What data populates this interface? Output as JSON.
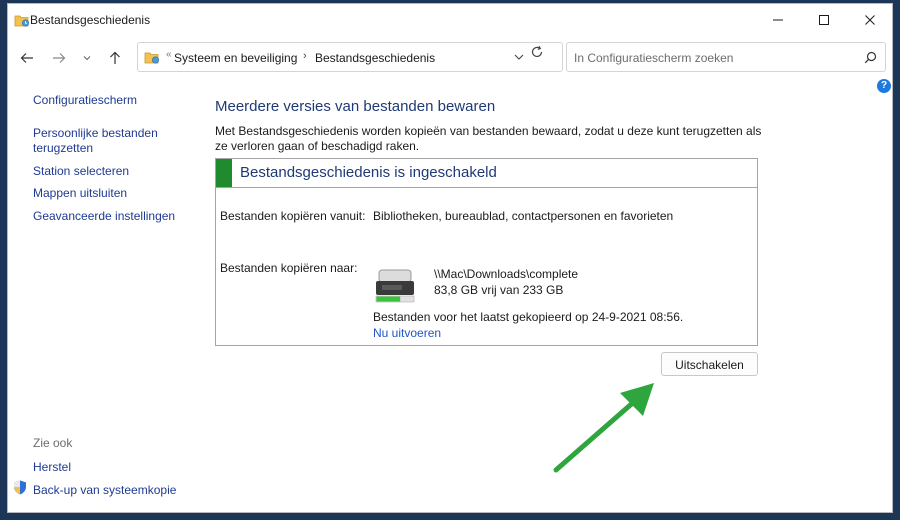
{
  "window": {
    "title": "Bestandsgeschiedenis",
    "minimize_icon": "minimize-icon",
    "maximize_icon": "maximize-icon",
    "close_icon": "close-icon"
  },
  "nav": {
    "breadcrumbs": [
      "Systeem en beveiliging",
      "Bestandsgeschiedenis"
    ],
    "breadcrumb_prefix": "«",
    "breadcrumb_separator": "›"
  },
  "search": {
    "placeholder": "In Configuratiescherm zoeken"
  },
  "help": {
    "label": "?"
  },
  "sidebar": {
    "links": [
      {
        "label": "Configuratiescherm"
      },
      {
        "label": "Persoonlijke bestanden terugzetten"
      },
      {
        "label": "Station selecteren"
      },
      {
        "label": "Mappen uitsluiten"
      },
      {
        "label": "Geavanceerde instellingen"
      }
    ],
    "see_also_heading": "Zie ook",
    "see_also": [
      {
        "label": "Herstel"
      },
      {
        "label": "Back-up van systeemkopie"
      }
    ]
  },
  "main": {
    "title": "Meerdere versies van bestanden bewaren",
    "description": "Met Bestandsgeschiedenis worden kopieën van bestanden bewaard, zodat u deze kunt terugzetten als ze verloren gaan of beschadigd raken.",
    "status": "Bestandsgeschiedenis is ingeschakeld",
    "copy_from_label": "Bestanden kopiëren vanuit:",
    "copy_from_value": "Bibliotheken, bureaublad, contactpersonen en favorieten",
    "copy_to_label": "Bestanden kopiëren naar:",
    "drive_path": "\\\\Mac\\Downloads\\complete",
    "drive_space": "83,8 GB vrij van 233 GB",
    "drive_free_fraction": 0.36,
    "last_copied": "Bestanden voor het laatst gekopieerd op 24-9-2021 08:56.",
    "run_now": "Nu uitvoeren",
    "turn_off_button": "Uitschakelen"
  },
  "colors": {
    "accent_green": "#1f8a2e",
    "title_blue": "#1f3a76",
    "link_blue": "#1f55c8",
    "arrow_green": "#2fa53d"
  }
}
